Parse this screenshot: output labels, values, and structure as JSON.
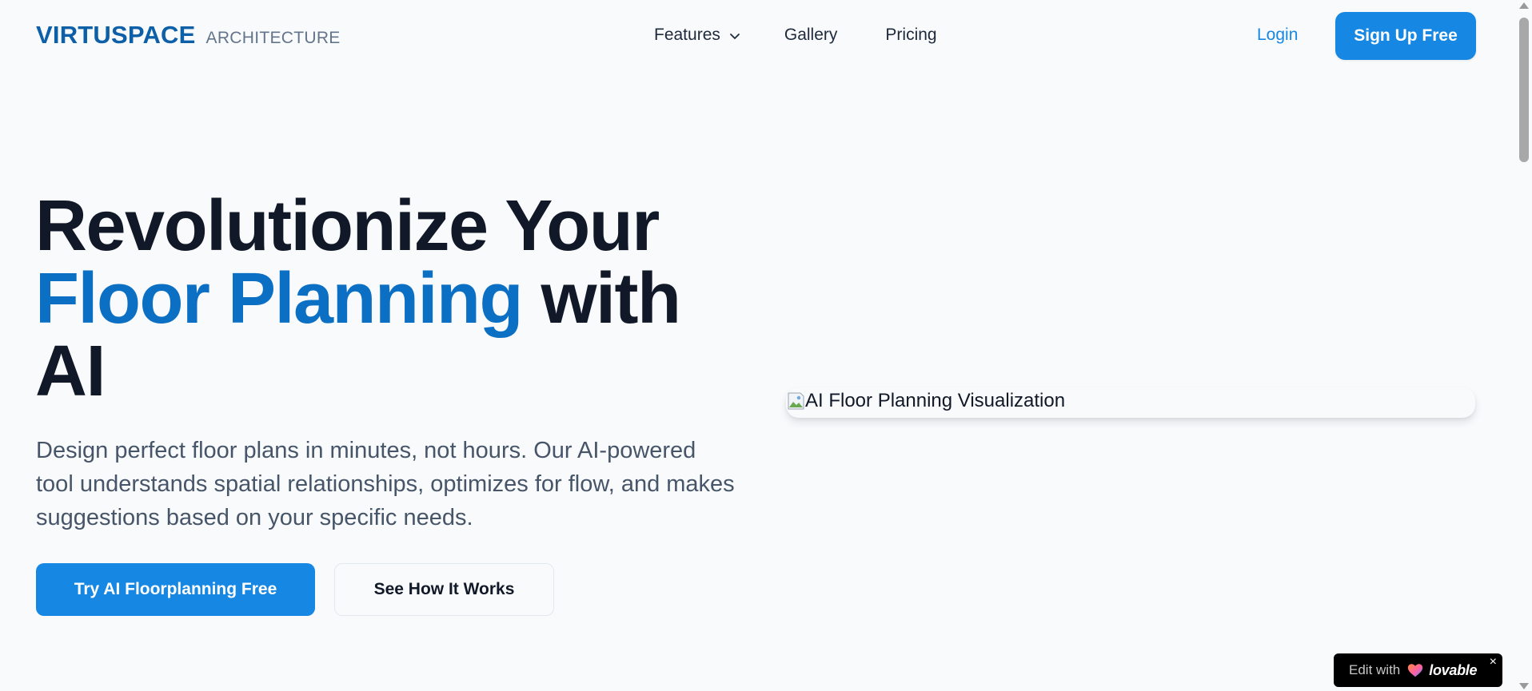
{
  "header": {
    "brand_name": "VIRTUSPACE",
    "brand_sub": "ARCHITECTURE",
    "nav": {
      "features": "Features",
      "gallery": "Gallery",
      "pricing": "Pricing"
    },
    "login": "Login",
    "signup": "Sign Up Free"
  },
  "hero": {
    "title_line1": "Revolutionize Your",
    "title_accent": "Floor Planning",
    "title_after_accent": " with",
    "title_line3": "AI",
    "description": "Design perfect floor plans in minutes, not hours. Our AI-powered tool understands spatial relationships, optimizes for flow, and makes suggestions based on your specific needs.",
    "primary_cta": "Try AI Floorplanning Free",
    "secondary_cta": "See How It Works"
  },
  "visual": {
    "alt_text": "AI Floor Planning Visualization"
  },
  "badge": {
    "prefix": "Edit with",
    "brand": "lovable",
    "close": "×"
  },
  "colors": {
    "brand_blue": "#0d5fa8",
    "accent_blue": "#1687e2",
    "heading_accent": "#0b6fc4",
    "background": "#f8fafc",
    "heading": "#111827",
    "body_text": "#475569"
  },
  "icons": {
    "features_dropdown": "chevron-down-icon",
    "visual_placeholder": "broken-image-icon",
    "badge_logo": "heart-icon",
    "badge_close": "close-icon"
  }
}
